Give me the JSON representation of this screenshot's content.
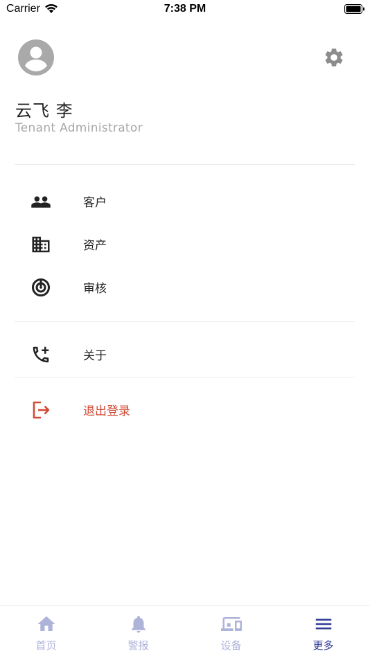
{
  "status_bar": {
    "carrier": "Carrier",
    "time": "7:38 PM"
  },
  "profile": {
    "name": "云飞 李",
    "role": "Tenant Administrator",
    "avatar_icon": "account-circle-icon",
    "settings_icon": "gear-icon"
  },
  "menu": {
    "items": [
      {
        "label": "客户",
        "icon": "people-icon"
      },
      {
        "label": "资产",
        "icon": "building-icon"
      },
      {
        "label": "审核",
        "icon": "radar-icon"
      }
    ],
    "about": {
      "label": "关于",
      "icon": "phone-add-icon"
    },
    "logout": {
      "label": "退出登录",
      "icon": "logout-icon",
      "color": "#d24a37"
    }
  },
  "bottom_nav": {
    "items": [
      {
        "label": "首页",
        "icon": "home-icon",
        "active": false
      },
      {
        "label": "警报",
        "icon": "bell-icon",
        "active": false
      },
      {
        "label": "设备",
        "icon": "devices-icon",
        "active": false
      },
      {
        "label": "更多",
        "icon": "menu-icon",
        "active": true
      }
    ],
    "active_color": "#2f3b93",
    "inactive_color": "#aeb3da"
  }
}
